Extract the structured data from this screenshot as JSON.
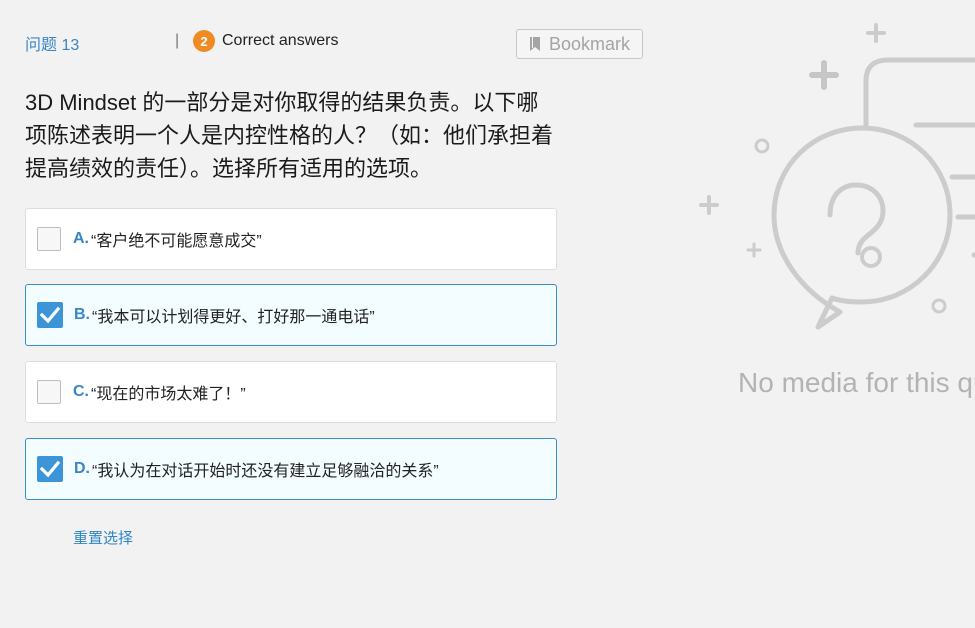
{
  "header": {
    "question_number": "问题 13",
    "separator": "|",
    "correct_count": "2",
    "correct_label": "Correct answers",
    "bookmark_label": "Bookmark"
  },
  "question": {
    "text": "3D Mindset 的一部分是对你取得的结果负责。以下哪项陈述表明一个人是内控性格的人？（如：他们承担着提高绩效的责任）。选择所有适用的选项。"
  },
  "options": [
    {
      "letter": "A.",
      "text": "“客户绝不可能愿意成交”",
      "checked": false
    },
    {
      "letter": "B.",
      "text": "“我本可以计划得更好、打好那一通电话”",
      "checked": true
    },
    {
      "letter": "C.",
      "text": "“现在的市场太难了！”",
      "checked": false
    },
    {
      "letter": "D.",
      "text": "“我认为在对话开始时还没有建立足够融洽的关系”",
      "checked": true
    }
  ],
  "reset_label": "重置选择",
  "media": {
    "icon": "question-bubble-icon",
    "no_media_text": "No media for this question"
  },
  "colors": {
    "accent_blue": "#3a86c4",
    "checkbox_checked": "#3c95d6",
    "badge_orange": "#f08a24",
    "selected_border": "#3d8ec8",
    "selected_bg": "#f3fcfe"
  }
}
